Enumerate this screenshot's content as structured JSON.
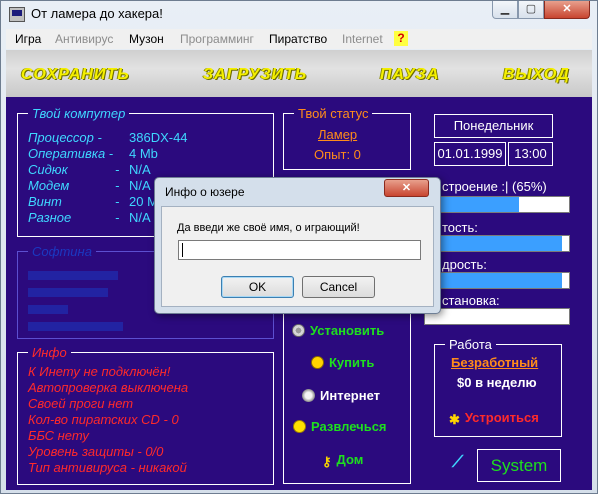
{
  "window": {
    "title": "От ламера до хакера!"
  },
  "menu": [
    {
      "label": "Игра",
      "disabled": false
    },
    {
      "label": "Антивирус",
      "disabled": true
    },
    {
      "label": "Музон",
      "disabled": false
    },
    {
      "label": "Программинг",
      "disabled": true
    },
    {
      "label": "Пиратство",
      "disabled": false
    },
    {
      "label": "Internet",
      "disabled": true
    }
  ],
  "help_label": "?",
  "toolbar": {
    "save": "СОХРАНИТЬ",
    "load": "ЗАГРУЗИТЬ",
    "pause": "ПАУЗА",
    "exit": "ВЫХОД"
  },
  "computer": {
    "title": "Твой компутер",
    "rows": [
      {
        "label": "Процессор",
        "sep": "-",
        "value": "386DX-44"
      },
      {
        "label": "Оперативка",
        "sep": "-",
        "value": "4 Mb"
      },
      {
        "label": "Сидюк",
        "sep": "-",
        "value": "N/A"
      },
      {
        "label": "Модем",
        "sep": "-",
        "value": "N/A"
      },
      {
        "label": "Винт",
        "sep": "-",
        "value": "20 M"
      },
      {
        "label": "Разное",
        "sep": "-",
        "value": "N/A"
      }
    ]
  },
  "software": {
    "title": "Софтина"
  },
  "info": {
    "title": "Инфо",
    "lines": [
      "К Инету не подключён!",
      "Автопроверка выключена",
      "Своей проги нет",
      "Кол-во пиратских CD - 0",
      "ББС нету",
      "Уровень защиты - 0/0",
      "Тип антивируса - никакой"
    ]
  },
  "status": {
    "title": "Твой статус",
    "rank": "Ламер",
    "exp": "Опыт: 0"
  },
  "date": {
    "weekday": "Понедельник",
    "date": "01.01.1999",
    "time": "13:00"
  },
  "bars": [
    {
      "label": "строение :| (65%)",
      "fill": 0.65
    },
    {
      "label": "тость:",
      "fill": 0.95
    },
    {
      "label": "дрость:",
      "fill": 0.95
    },
    {
      "label": "становка:",
      "fill": 0.0
    }
  ],
  "actions": [
    {
      "label": "Установить"
    },
    {
      "label": "Купить"
    },
    {
      "label": "Интернет"
    },
    {
      "label": "Развлечься"
    },
    {
      "label": "Дом"
    }
  ],
  "work": {
    "title": "Работа",
    "job": "Безработный",
    "salary": "$0 в неделю",
    "apply": "Устроиться"
  },
  "system_button": "System",
  "dialog": {
    "title": "Инфо о юзере",
    "close": "✕",
    "prompt": "Да введи же своё имя, о играющий!",
    "value": "",
    "ok": "OK",
    "cancel": "Cancel"
  },
  "colors": {
    "panel_bg": "#2b0a7e",
    "cyan": "#3fd7ff",
    "orange": "#ff8c1a",
    "green": "#1ee01e",
    "red": "#ff2a2a",
    "yellow": "#f5f000"
  }
}
